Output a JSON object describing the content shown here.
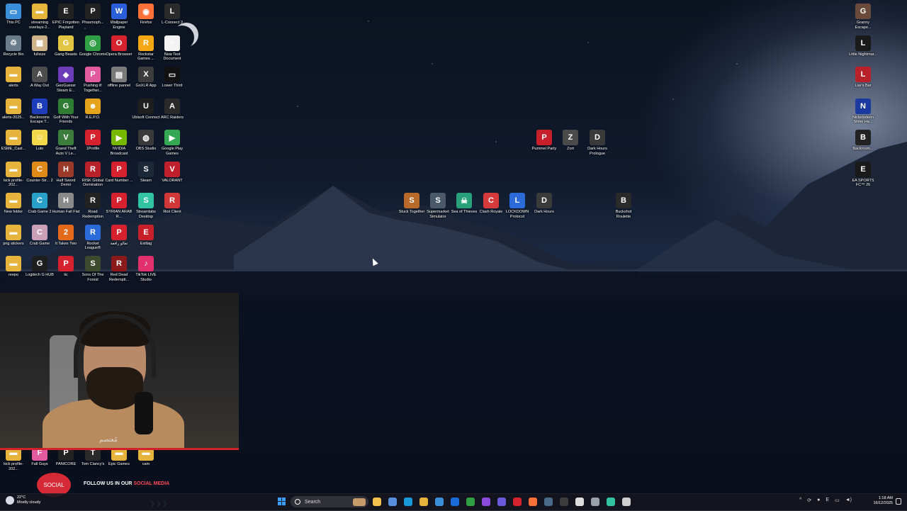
{
  "desktop_icons": [
    {
      "label": "This PC",
      "color": "#3a8fd8",
      "glyph": "▭"
    },
    {
      "label": "streaming overlays-2...",
      "color": "#e6b43c",
      "glyph": "▬"
    },
    {
      "label": "EPIC Forgotten Playland",
      "color": "#222222",
      "glyph": "E"
    },
    {
      "label": "Phasmoph...",
      "color": "#222222",
      "glyph": "P"
    },
    {
      "label": "Wallpaper Engine",
      "color": "#2b5fd9",
      "glyph": "W"
    },
    {
      "label": "Firefox",
      "color": "#ff7139",
      "glyph": "◉"
    },
    {
      "label": "L-Connect 3",
      "color": "#2b2b2b",
      "glyph": "L"
    },
    {
      "label": "Recycle Bin",
      "color": "#6a7b8c",
      "glyph": "♲"
    },
    {
      "label": "fullsize",
      "color": "#cfb38a",
      "glyph": "▦"
    },
    {
      "label": "Gang Beasts",
      "color": "#e2c542",
      "glyph": "G"
    },
    {
      "label": "Google Chrome",
      "color": "#2f9e44",
      "glyph": "◎"
    },
    {
      "label": "Opera Browser",
      "color": "#d6212e",
      "glyph": "O"
    },
    {
      "label": "Rockstar Games ...",
      "color": "#f3a712",
      "glyph": "R"
    },
    {
      "label": "New Text Document",
      "color": "#f3f3f3",
      "glyph": "≡"
    },
    {
      "label": "alerts",
      "color": "#e6b43c",
      "glyph": "▬"
    },
    {
      "label": "A Way Out",
      "color": "#4d4d4d",
      "glyph": "A"
    },
    {
      "label": "GeoGuessr Steam E...",
      "color": "#6c3cb9",
      "glyph": "◆"
    },
    {
      "label": "Pushing it! Together...",
      "color": "#e25aa0",
      "glyph": "P"
    },
    {
      "label": "offline pannel",
      "color": "#7a7a7a",
      "glyph": "▤"
    },
    {
      "label": "GoXLR App",
      "color": "#3c3c3c",
      "glyph": "X"
    },
    {
      "label": "Lower Third",
      "color": "#111111",
      "glyph": "▭"
    },
    {
      "label": "alerts-2025...",
      "color": "#e6b43c",
      "glyph": "▬"
    },
    {
      "label": "Backrooms Escape T...",
      "color": "#1d3dbb",
      "glyph": "B"
    },
    {
      "label": "Golf With Your Friends",
      "color": "#2f7d32",
      "glyph": "G"
    },
    {
      "label": "R.E.P.O.",
      "color": "#e5a21b",
      "glyph": "☻"
    },
    {
      "label": "",
      "color": "transparent",
      "glyph": ""
    },
    {
      "label": "Ubisoft Connect",
      "color": "#1f1f1f",
      "glyph": "U"
    },
    {
      "label": "ARC Raiders",
      "color": "#2a2a2a",
      "glyph": "A"
    },
    {
      "label": "ESME_Cast...",
      "color": "#e6b43c",
      "glyph": "▬"
    },
    {
      "label": "Luto",
      "color": "#f2d84a",
      "glyph": "☺"
    },
    {
      "label": "Grand Theft Auto V Le...",
      "color": "#3c7d3c",
      "glyph": "V"
    },
    {
      "label": "1Profile",
      "color": "#d6212e",
      "glyph": "P"
    },
    {
      "label": "NVIDIA Broadcast",
      "color": "#76b900",
      "glyph": "▶"
    },
    {
      "label": "OBS Studio",
      "color": "#3a3a3a",
      "glyph": "◍"
    },
    {
      "label": "Google Play Games",
      "color": "#34a853",
      "glyph": "▶"
    },
    {
      "label": "kick profile-202...",
      "color": "#e6b43c",
      "glyph": "▬"
    },
    {
      "label": "Counter-Str... 2",
      "color": "#e08a1a",
      "glyph": "C"
    },
    {
      "label": "Half Sword Demo",
      "color": "#9a3a2a",
      "glyph": "H"
    },
    {
      "label": "RISK Global Domination",
      "color": "#b8202a",
      "glyph": "R"
    },
    {
      "label": "Card Number ...",
      "color": "#d6212e",
      "glyph": "P"
    },
    {
      "label": "Steam",
      "color": "#1b2838",
      "glyph": "S"
    },
    {
      "label": "VALORANT",
      "color": "#c0202e",
      "glyph": "V"
    },
    {
      "label": "New folder",
      "color": "#e6b43c",
      "glyph": "▬"
    },
    {
      "label": "Crab Game 2",
      "color": "#2aa0c8",
      "glyph": "C"
    },
    {
      "label": "Human Fall Flat",
      "color": "#8a8a8a",
      "glyph": "H"
    },
    {
      "label": "Road Redemption",
      "color": "#222222",
      "glyph": "R"
    },
    {
      "label": "SYRIAN ARAB R...",
      "color": "#d6212e",
      "glyph": "P"
    },
    {
      "label": "Streamlabs Desktop",
      "color": "#31c3a2",
      "glyph": "S"
    },
    {
      "label": "Riot Client",
      "color": "#d13639",
      "glyph": "R"
    },
    {
      "label": "png stickers",
      "color": "#e6b43c",
      "glyph": "▬"
    },
    {
      "label": "Crab Game",
      "color": "#c8a0b8",
      "glyph": "C"
    },
    {
      "label": "It Takes Two",
      "color": "#e26a1a",
      "glyph": "2"
    },
    {
      "label": "Rocket League®",
      "color": "#2a6ad9",
      "glyph": "R"
    },
    {
      "label": "تعالو رافعة",
      "color": "#d6212e",
      "glyph": "P"
    },
    {
      "label": "Exitlag",
      "color": "#c8202a",
      "glyph": "E"
    },
    {
      "label": "",
      "color": "transparent",
      "glyph": ""
    },
    {
      "label": "reepo",
      "color": "#e6b43c",
      "glyph": "▬"
    },
    {
      "label": "Logitech G HUB",
      "color": "#1e1e1e",
      "glyph": "G"
    },
    {
      "label": "tic",
      "color": "#d6212e",
      "glyph": "P"
    },
    {
      "label": "Sons Of The Forest",
      "color": "#3d4a2d",
      "glyph": "S"
    },
    {
      "label": "Red Dead Redempti...",
      "color": "#8b1a1a",
      "glyph": "R"
    },
    {
      "label": "TikTok LIVE Studio",
      "color": "#e1306c",
      "glyph": "♪"
    }
  ],
  "bottom_left_icons": [
    {
      "label": "kick profile-202...",
      "color": "#e6b43c",
      "glyph": "▬"
    },
    {
      "label": "Fall Guys",
      "color": "#e25aa0",
      "glyph": "F"
    },
    {
      "label": "PANICORE",
      "color": "#222222",
      "glyph": "P"
    },
    {
      "label": "Tom Clancy's",
      "color": "#2a2a2a",
      "glyph": "T"
    },
    {
      "label": "Epic Games",
      "color": "#e6b43c",
      "glyph": "▬"
    },
    {
      "label": "cam",
      "color": "#e6b43c",
      "glyph": "▬"
    }
  ],
  "center_icons_row1": [
    {
      "label": "Pummel Party",
      "color": "#c8202a",
      "glyph": "P"
    },
    {
      "label": "Zort",
      "color": "#4a4a4a",
      "glyph": "Z"
    },
    {
      "label": "Dark Hours Prologue",
      "color": "#3a3a3a",
      "glyph": "D"
    }
  ],
  "center_icons_row2": [
    {
      "label": "Stuck Together",
      "color": "#b86a2a",
      "glyph": "S"
    },
    {
      "label": "Supermarket Simulator",
      "color": "#4a5a6a",
      "glyph": "S"
    },
    {
      "label": "Sea of Thieves",
      "color": "#28a07a",
      "glyph": "☠"
    },
    {
      "label": "Clash Royale",
      "color": "#d63a3a",
      "glyph": "C"
    },
    {
      "label": "LOCKDOWN Protocol",
      "color": "#2a6ad9",
      "glyph": "L"
    },
    {
      "label": "Dark Hours",
      "color": "#3a3a3a",
      "glyph": "D"
    },
    {
      "label": "Buckshot Roulette",
      "color": "#2a2a2a",
      "glyph": "B"
    }
  ],
  "right_icons": [
    {
      "label": "Granny Escape...",
      "color": "#6a4a3a",
      "glyph": "G"
    },
    {
      "label": "Little Nightmar...",
      "color": "#1a1a1a",
      "glyph": "L"
    },
    {
      "label": "Liar's Bar",
      "color": "#b8202a",
      "glyph": "L"
    },
    {
      "label": "Nickelodeon Slime Ha...",
      "color": "#1a3aa0",
      "glyph": "N"
    },
    {
      "label": "Backroom...",
      "color": "#222222",
      "glyph": "B"
    },
    {
      "label": "EA SPORTS FC™ 26",
      "color": "#1a1a1a",
      "glyph": "E"
    }
  ],
  "webcam": {
    "signature": "مُعتصم"
  },
  "social": {
    "logo_text": "SOCIAL",
    "follow_text": "FOLLOW US IN OUR ",
    "social_media": "SOCIAL MEDIA",
    "arrows": "❯❯❯"
  },
  "taskbar": {
    "weather_temp": "22°C",
    "weather_desc": "Mostly cloudy",
    "search_placeholder": "Search",
    "time": "1:18 AM",
    "date": "16/12/2025",
    "apps": [
      {
        "name": "file-explorer-icon",
        "color": "#f2c14e"
      },
      {
        "name": "copilot-icon",
        "color": "#5a8fe0"
      },
      {
        "name": "edge-icon",
        "color": "#1a9ad9"
      },
      {
        "name": "folder-icon",
        "color": "#e6b43c"
      },
      {
        "name": "store-icon",
        "color": "#3a8fd8"
      },
      {
        "name": "outlook-icon",
        "color": "#1a6ad9"
      },
      {
        "name": "chrome-icon",
        "color": "#2f9e44"
      },
      {
        "name": "messenger-icon",
        "color": "#8a4adb"
      },
      {
        "name": "teams-icon",
        "color": "#6a5adb"
      },
      {
        "name": "opera-icon",
        "color": "#d6212e"
      },
      {
        "name": "firefox-icon",
        "color": "#ff7139"
      },
      {
        "name": "steam-icon",
        "color": "#4a6a8a"
      },
      {
        "name": "goxlr-icon",
        "color": "#3c3c3c"
      },
      {
        "name": "capcut-icon",
        "color": "#dddddd"
      },
      {
        "name": "chat-icon",
        "color": "#9aa0a8"
      },
      {
        "name": "streamlabs-icon",
        "color": "#31c3a2"
      },
      {
        "name": "ghub-icon",
        "color": "#cfcfcf"
      }
    ]
  }
}
